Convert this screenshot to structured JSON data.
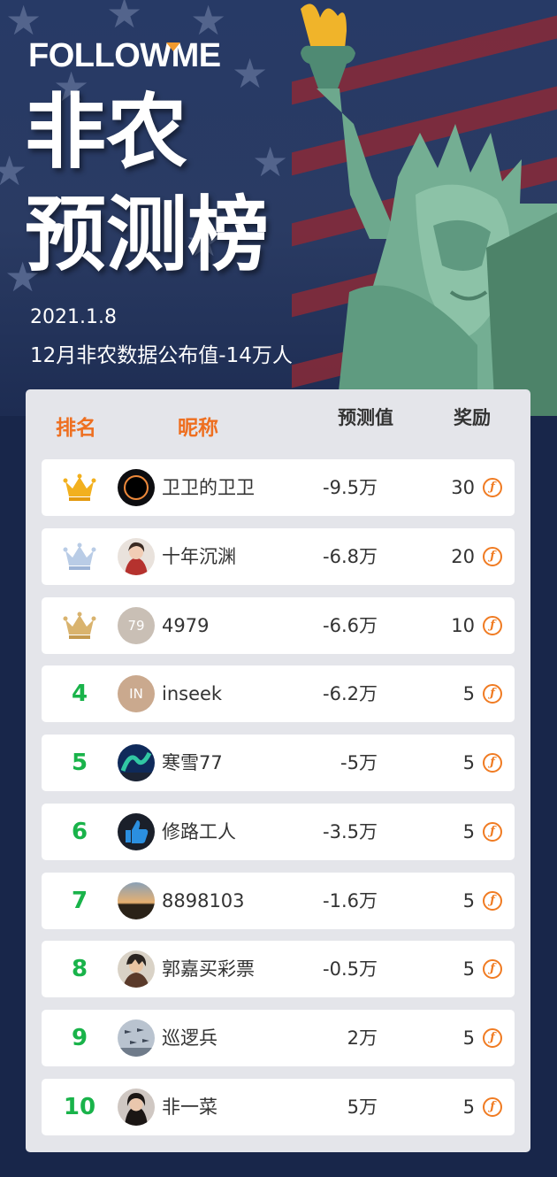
{
  "brand": {
    "logo_text": "FOLLOWME"
  },
  "hero": {
    "title_line1": "非农",
    "title_line2": "预测榜",
    "date": "2021.1.8",
    "subtitle": "12月非农数据公布值-14万人"
  },
  "table": {
    "headers": {
      "rank": "排名",
      "nickname": "昵称",
      "prediction": "预测值",
      "reward": "奖励"
    },
    "rows": [
      {
        "rank": "1",
        "badge": "gold-crown",
        "avatar_icon": "eclipse-avatar",
        "nickname": "卫卫的卫卫",
        "prediction": "-9.5万",
        "reward": "30"
      },
      {
        "rank": "2",
        "badge": "silver-crown",
        "avatar_icon": "person-photo-avatar",
        "nickname": "十年沉渊",
        "prediction": "-6.8万",
        "reward": "20"
      },
      {
        "rank": "3",
        "badge": "bronze-crown",
        "avatar_text": "79",
        "nickname": "4979",
        "prediction": "-6.6万",
        "reward": "10"
      },
      {
        "rank": "4",
        "avatar_text": "IN",
        "nickname": "inseek",
        "prediction": "-6.2万",
        "reward": "5"
      },
      {
        "rank": "5",
        "avatar_icon": "aurora-avatar",
        "nickname": "寒雪77",
        "prediction": "-5万",
        "reward": "5"
      },
      {
        "rank": "6",
        "avatar_icon": "thumbs-up-avatar",
        "nickname": "修路工人",
        "prediction": "-3.5万",
        "reward": "5"
      },
      {
        "rank": "7",
        "avatar_icon": "sunset-avatar",
        "nickname": "8898103",
        "prediction": "-1.6万",
        "reward": "5"
      },
      {
        "rank": "8",
        "avatar_icon": "anime-character-avatar",
        "nickname": "郭嘉买彩票",
        "prediction": "-0.5万",
        "reward": "5"
      },
      {
        "rank": "9",
        "avatar_icon": "jets-avatar",
        "nickname": "巡逻兵",
        "prediction": "2万",
        "reward": "5"
      },
      {
        "rank": "10",
        "avatar_icon": "portrait-avatar",
        "nickname": "非一菜",
        "prediction": "5万",
        "reward": "5"
      }
    ]
  },
  "colors": {
    "header_text": "#ee6f20",
    "rank_number": "#19b34a",
    "coin": "#f07b22",
    "gold": "#f2b01e",
    "silver": "#b9cce6",
    "bronze": "#d9b36e",
    "panel_bg": "#e4e5ea",
    "page_bg": "#18264a"
  }
}
